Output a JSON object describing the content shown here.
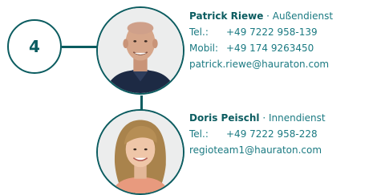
{
  "step_number": "4",
  "contacts": [
    {
      "name": "Patrick Riewe",
      "separator": " · ",
      "role": "Außendienst",
      "tel_label": "Tel.:",
      "tel": "+49 7222 958-139",
      "mobile_label": "Mobil:",
      "mobile": "+49 174 9263450",
      "email": "patrick.riewe@hauraton.com"
    },
    {
      "name": "Doris Peischl",
      "separator": " · ",
      "role": "Innendienst",
      "tel_label": "Tel.:",
      "tel": "+49 7222 958-228",
      "email": "regioteam1@hauraton.com"
    }
  ],
  "colors": {
    "accent": "#0b5c60",
    "text": "#1b7a82"
  }
}
